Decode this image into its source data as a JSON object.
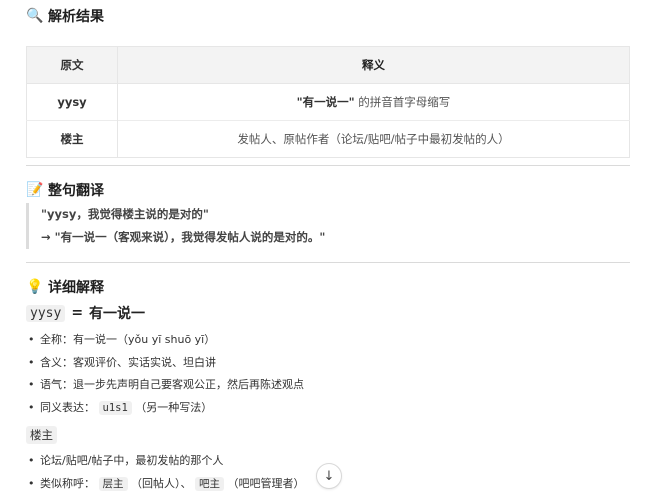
{
  "sections": {
    "analysis": {
      "icon": "🔍",
      "title": "解析结果"
    },
    "translation": {
      "icon": "📝",
      "title": "整句翻译"
    },
    "detail": {
      "icon": "💡",
      "title": "详细解释"
    }
  },
  "table": {
    "headers": [
      "原文",
      "释义"
    ],
    "rows": [
      {
        "term": "yysy",
        "meaning_bold": "\"有一说一\"",
        "meaning_rest": " 的拼音首字母缩写"
      },
      {
        "term": "楼主",
        "meaning_bold": "",
        "meaning_rest": "发帖人、原帖作者（论坛/贴吧/帖子中最初发帖的人）"
      }
    ]
  },
  "quote": {
    "line1": "\"yysy，我觉得楼主说的是对的\"",
    "line2": "→ \"有一说一（客观来说），我觉得发帖人说的是对的。\""
  },
  "yysy": {
    "code": "yysy",
    "equals": "=",
    "meaning": "有一说一",
    "items": [
      "全称：有一说一（yǒu yī shuō yī）",
      "含义：客观评价、实话实说、坦白讲",
      "语气：退一步先声明自己要客观公正，然后再陈述观点"
    ],
    "synonym_prefix": "同义表达：",
    "synonym_code": "u1s1",
    "synonym_suffix": "（另一种写法）"
  },
  "louzhu": {
    "code": "楼主",
    "item1": "论坛/贴吧/帖子中，最初发帖的那个人",
    "item2_prefix": "类似称呼：",
    "item2_code1": "层主",
    "item2_mid": "（回帖人）、",
    "item2_code2": "吧主",
    "item2_suffix": "（吧吧管理者）"
  },
  "scroll_button": {
    "icon": "↓"
  }
}
